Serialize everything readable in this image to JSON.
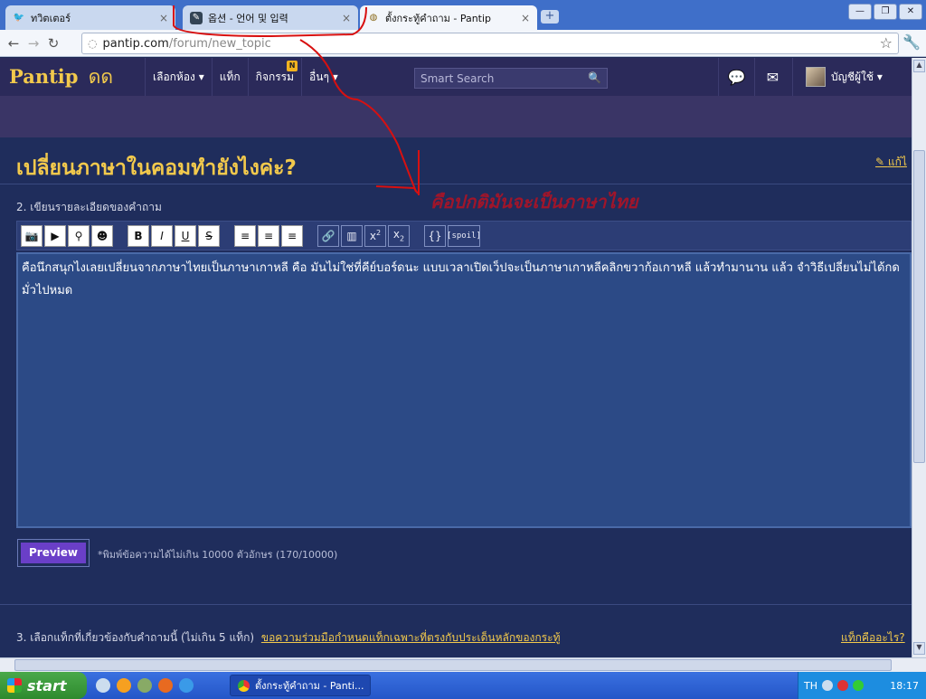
{
  "browser": {
    "tabs": [
      {
        "label": "ทวิตเตอร์",
        "active": false
      },
      {
        "label": "옵션 - 언어 및 입력",
        "active": false
      },
      {
        "label": "ตั้งกระทู้คำถาม - Pantip",
        "active": true
      }
    ],
    "url_host": "pantip.com",
    "url_path": "/forum/new_topic"
  },
  "header": {
    "logo": "Pantip",
    "logo_mark": "ดด",
    "nav": [
      "เลือกห้อง ▾",
      "แท็ก",
      "กิจกรรม",
      "อื่นๆ ▾"
    ],
    "new_badge": "N",
    "search_placeholder": "Smart Search",
    "account": "บัญชีผู้ใช้ ▾"
  },
  "page": {
    "title": "เปลี่ยนภาษาในคอมทำยังไงค่ะ?",
    "edit_link": "แก้ไ",
    "step2_label": "2. เขียนรายละเอียดของคำถาม",
    "annotation": "คือปกติมันจะเป็นภาษาไทย",
    "body_text": "คือนึกสนุกไงเลยเปลี่ยนจากภาษาไทยเป็นภาษาเกาหลี คือ มันไม่ใช่ที่คีย์บอร์ดนะ แบบเวลาเปิดเว็ปจะเป็นภาษาเกาหลีคลิกขวาก้อเกาหลี แล้วทำมานาน แล้ว จำวิธีเปลี่ยนไม่ได้กดมั่วไปหมด",
    "preview_label": "Preview",
    "char_limit": "*พิมพ์ข้อความได้ไม่เกิน 10000 ตัวอักษร (170/10000)",
    "step3_label": "3. เลือกแท็กที่เกี่ยวข้องกับคำถามนี้ (ไม่เกิน 5 แท็ก)",
    "step3_link": "ขอความร่วมมือกำหนดแท็กเฉพาะที่ตรงกับประเด็นหลักของกระทู้",
    "what_tags": "แท็กคืออะไร?"
  },
  "editor_tools": [
    "B",
    "I",
    "U",
    "S",
    "x2",
    "x2",
    "{}",
    "[spoil]"
  ],
  "taskbar": {
    "start": "start",
    "task_label": "ตั้งกระทู้คำถาม - Panti...",
    "lang": "TH",
    "clock": "18:17"
  },
  "colors": {
    "accent_yellow": "#f2c94c",
    "page_bg": "#1f2d5c",
    "annotation_red": "#a0152a"
  }
}
